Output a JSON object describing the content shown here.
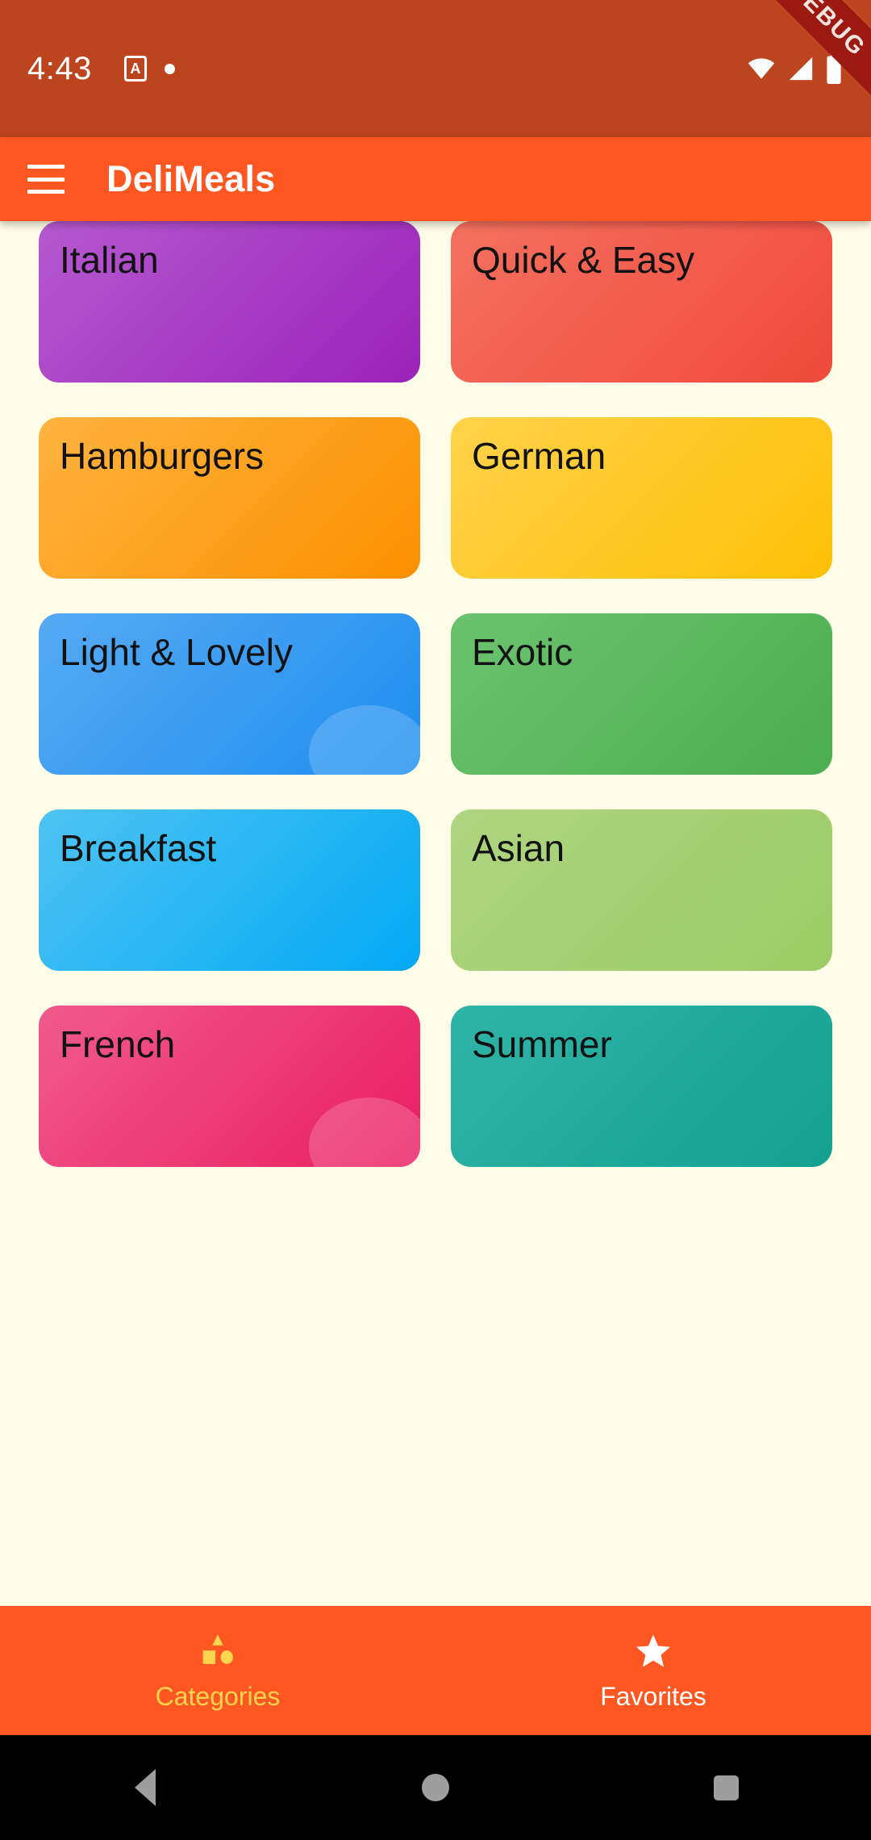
{
  "statusbar": {
    "time": "4:43",
    "a_icon": "A",
    "icons": [
      "a-badge-icon",
      "dot-icon",
      "wifi-icon",
      "cell-signal-icon",
      "battery-icon"
    ],
    "debug_banner": "DEBUG",
    "background": "#BC4520",
    "ribbon_color": "#9C1A12"
  },
  "appbar": {
    "title": "DeliMeals",
    "menu_icon": "hamburger-menu-icon",
    "background": "#FF5722"
  },
  "page": {
    "background": "#FFFDE7"
  },
  "categories": [
    {
      "label": "Italian",
      "from": "#B55AD0",
      "to": "#9B22B8"
    },
    {
      "label": "Quick & Easy",
      "from": "#F4705F",
      "to": "#F04A3C"
    },
    {
      "label": "Hamburgers",
      "from": "#FFB340",
      "to": "#FB9000"
    },
    {
      "label": "German",
      "from": "#FFD24A",
      "to": "#FDC007"
    },
    {
      "label": "Light & Lovely",
      "from": "#56AAF2",
      "to": "#1E8EF0"
    },
    {
      "label": "Exotic",
      "from": "#6CC36F",
      "to": "#4AAD4F"
    },
    {
      "label": "Breakfast",
      "from": "#4FC3F2",
      "to": "#03A9F4"
    },
    {
      "label": "Asian",
      "from": "#AED581",
      "to": "#9CCC65"
    },
    {
      "label": "French",
      "from": "#F05A8C",
      "to": "#EA1E63"
    },
    {
      "label": "Summer",
      "from": "#2FB5A8",
      "to": "#14A090"
    }
  ],
  "bottomnav": {
    "background": "#FF5722",
    "active_color": "#FFD54F",
    "inactive_color": "#FFFFFF",
    "items": [
      {
        "label": "Categories",
        "icon": "category-shapes-icon",
        "active": true
      },
      {
        "label": "Favorites",
        "icon": "star-icon",
        "active": false
      }
    ]
  },
  "androidnav": {
    "background": "#000000",
    "buttons": [
      {
        "icon": "back-triangle-icon"
      },
      {
        "icon": "home-circle-icon"
      },
      {
        "icon": "recents-square-icon"
      }
    ]
  }
}
